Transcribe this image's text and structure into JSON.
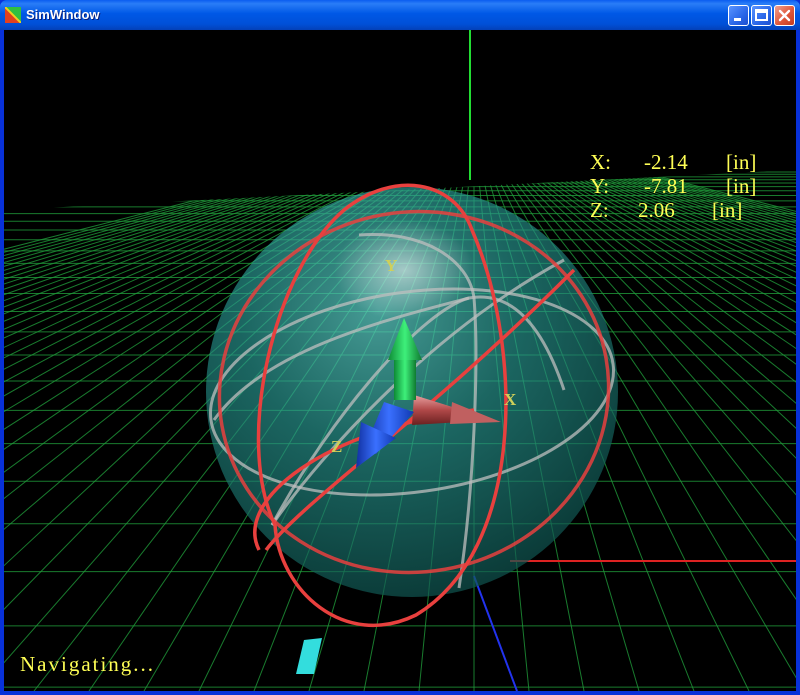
{
  "window": {
    "title": "SimWindow"
  },
  "controls": {
    "minimize": "minimize-button",
    "maximize": "maximize-button",
    "close": "close-button"
  },
  "readout": {
    "x_label": "X:",
    "x_value": "-2.14",
    "x_unit": "[in]",
    "y_label": "Y:",
    "y_value": "-7.81",
    "y_unit": "[in]",
    "z_label": "Z:",
    "z_value": "2.06",
    "z_unit": "[in]"
  },
  "axes_labels": {
    "x": "X",
    "y": "Y",
    "z": "Z"
  },
  "status": {
    "text": "Navigating..."
  },
  "colors": {
    "grid": "#1f9a3a",
    "sphere": "#1a8a86",
    "ring_red": "#e8403e",
    "readout": "#ffff55",
    "arrow_x": "#d05050",
    "arrow_y": "#22cc55",
    "arrow_z": "#2050e0"
  }
}
